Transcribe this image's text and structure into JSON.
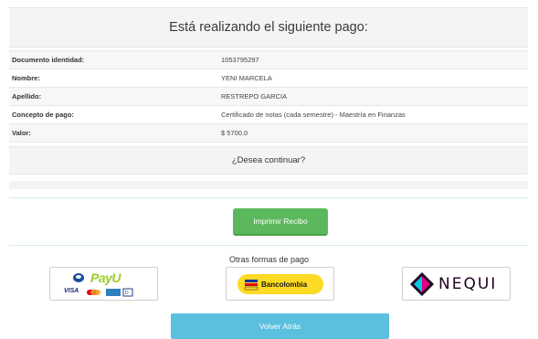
{
  "header": {
    "title": "Está realizando el siguiente pago:"
  },
  "details": [
    {
      "label": "Documento identidad:",
      "value": "1053795297"
    },
    {
      "label": "Nombre:",
      "value": "YENI MARCELA"
    },
    {
      "label": "Apellido:",
      "value": "RESTREPO GARCIA"
    },
    {
      "label": "Concepto de pago:",
      "value": "Certificado de notas (cada semestre) - Maestría en Finanzas"
    },
    {
      "label": "Valor:",
      "value": "$ 5700.0"
    }
  ],
  "question": "¿Desea continuar?",
  "actions": {
    "print_label": "Imprimir Recibo",
    "back_label": "Volver Atrás"
  },
  "other_payments": {
    "title": "Otras formas de pago",
    "payu": {
      "brand": "PayU",
      "card": "VISA",
      "icon": "payu-logo"
    },
    "bancolombia": {
      "brand": "Bancolombia",
      "icon": "bancolombia-logo"
    },
    "nequi": {
      "brand": "NEQUI",
      "icon": "nequi-logo"
    }
  },
  "colors": {
    "print_button": "#5cb85c",
    "back_button": "#5bc0de",
    "bancolombia_yellow": "#fdda24",
    "payu_green": "#9ccc2b"
  }
}
